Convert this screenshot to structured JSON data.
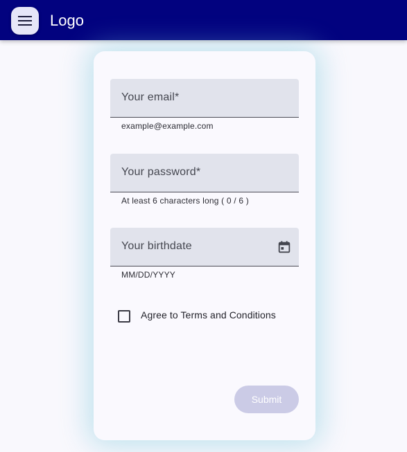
{
  "header": {
    "logo_text": "Logo",
    "menu_icon": "menu-icon"
  },
  "form": {
    "email": {
      "label": "Your email*",
      "helper": "example@example.com",
      "value": ""
    },
    "password": {
      "label": "Your password*",
      "helper": "At least 6 characters long ( 0 / 6 )",
      "value": ""
    },
    "birthdate": {
      "label": "Your birthdate",
      "helper": "MM/DD/YYYY",
      "value": "",
      "icon": "calendar-icon"
    },
    "terms": {
      "label": "Agree to Terms and Conditions",
      "checked": false
    },
    "submit_label": "Submit"
  },
  "colors": {
    "appbar": "#02027f",
    "field_background": "#e1e3ec",
    "submit_disabled": "#cbcbe6",
    "card_glow": "#78c8dc"
  }
}
